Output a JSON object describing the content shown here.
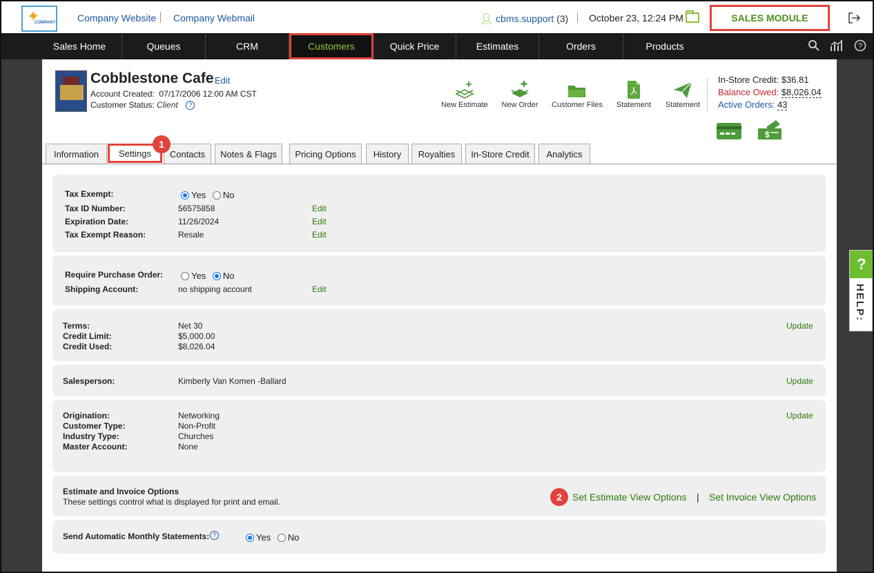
{
  "topbar": {
    "logo_text": "COMPANY",
    "links": [
      "Company Website",
      "Company Webmail"
    ],
    "user": "cbms.support",
    "user_count": "(3)",
    "datetime": "October 23, 12:24 PM",
    "module": "SALES MODULE"
  },
  "nav": [
    "Sales Home",
    "Queues",
    "CRM",
    "Customers",
    "Quick Price",
    "Estimates",
    "Orders",
    "Products"
  ],
  "customer": {
    "name": "Cobblestone Cafe",
    "edit": "Edit",
    "account_created_label": "Account Created:",
    "account_created": "07/17/2006 12:00 AM CST",
    "status_label": "Customer Status:",
    "status": "Client"
  },
  "actions": [
    "New Estimate",
    "New Order",
    "Customer Files",
    "Statement",
    "Statement"
  ],
  "credit": {
    "instore_label": "In-Store Credit:",
    "instore_value": "$36.81",
    "balance_label": "Balance Owed:",
    "balance_value": "$8,026.04",
    "orders_label": "Active Orders:",
    "orders_value": "43"
  },
  "tabs": [
    "Information",
    "Settings",
    "Contacts",
    "Notes & Flags",
    "Pricing Options",
    "History",
    "Royalties",
    "In-Store Credit",
    "Analytics"
  ],
  "badges": [
    "1",
    "2"
  ],
  "tax": {
    "exempt_label": "Tax Exempt:",
    "yes": "Yes",
    "no": "No",
    "id_label": "Tax ID Number:",
    "id_value": "56575858",
    "exp_label": "Expiration Date:",
    "exp_value": "11/26/2024",
    "reason_label": "Tax Exempt Reason:",
    "reason_value": "Resale",
    "edit": "Edit"
  },
  "po": {
    "require_label": "Require Purchase Order:",
    "shipping_label": "Shipping Account:",
    "shipping_value": "no shipping account"
  },
  "terms": {
    "terms_label": "Terms:",
    "terms_value": "Net 30",
    "limit_label": "Credit Limit:",
    "limit_value": "$5,000.00",
    "used_label": "Credit Used:",
    "used_value": "$8,026.04",
    "update": "Update"
  },
  "salesperson": {
    "label": "Salesperson:",
    "value": "Kimberly Van Komen -Ballard"
  },
  "origination": {
    "orig_label": "Origination:",
    "orig_value": "Networking",
    "type_label": "Customer Type:",
    "type_value": "Non-Profit",
    "industry_label": "Industry Type:",
    "industry_value": "Churches",
    "master_label": "Master Account:",
    "master_value": "None"
  },
  "options": {
    "title": "Estimate and Invoice Options",
    "desc": "These settings control what is displayed for print and email.",
    "estimate_link": "Set Estimate View Options",
    "sep": "|",
    "invoice_link": "Set Invoice View Options"
  },
  "statements": {
    "label": "Send Automatic Monthly Statements:"
  },
  "help": {
    "q": "?",
    "label": "HELP:"
  }
}
